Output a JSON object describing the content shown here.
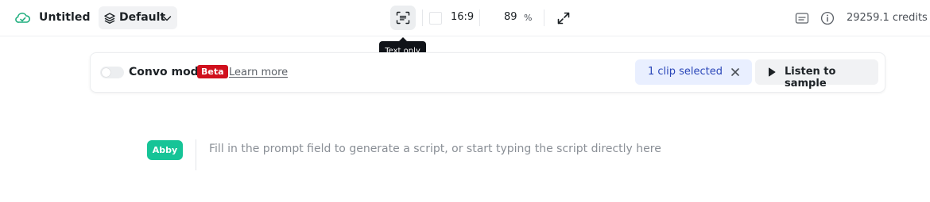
{
  "header": {
    "project_title": "Untitled",
    "preset_label": "Default",
    "aspect_ratio": "16:9",
    "zoom_value": "89",
    "zoom_unit": "%",
    "credits": "29259.1 credits",
    "icons": {
      "cloud": "cloud-saved-icon",
      "layers": "layers-icon",
      "chevron": "chevron-down-icon",
      "text_only": "text-only-icon",
      "expand": "expand-icon",
      "captions": "captions-icon",
      "info": "info-icon"
    }
  },
  "tooltip": {
    "text": "Text only"
  },
  "panel": {
    "convo_mode_label": "Convo mode",
    "convo_mode_on": false,
    "beta_badge": "Beta",
    "learn_more": "Learn more",
    "clip_selected": "1 clip selected",
    "listen_label": "Listen to sample"
  },
  "script": {
    "speaker": "Abby",
    "placeholder": "Fill in the prompt field to generate a script, or start typing the script directly here"
  },
  "colors": {
    "accent_green": "#16c497",
    "beta_red": "#d0101d",
    "clip_blue": "#2a46b8",
    "clip_bg": "#e9efff"
  }
}
